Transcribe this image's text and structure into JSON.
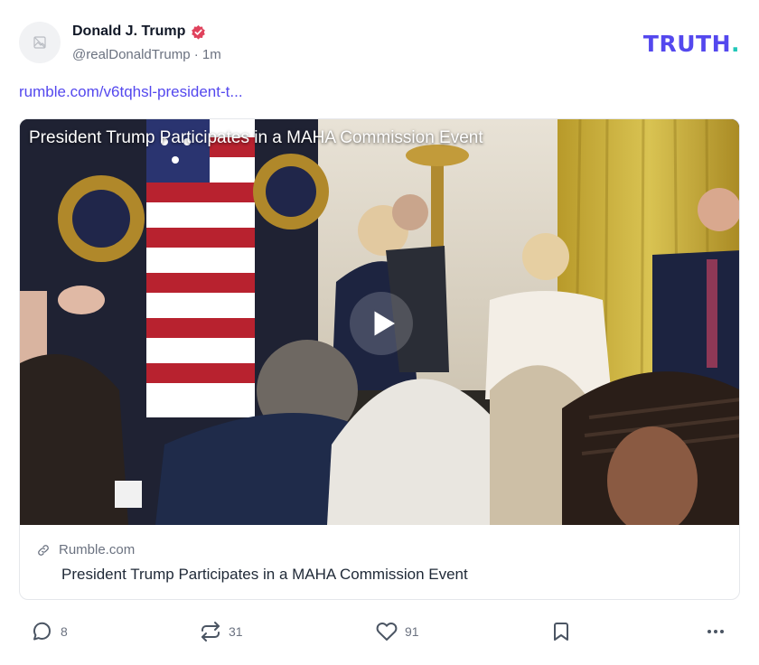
{
  "post": {
    "display_name": "Donald J. Trump",
    "handle": "@realDonaldTrump",
    "time_separator": " · ",
    "time": "1m",
    "link_text": "rumble.com/v6tqhsl-president-t...",
    "verified_icon": "verified-badge-icon",
    "avatar_icon": "image-placeholder-icon"
  },
  "brand": {
    "logo_text": "TRUTH",
    "logo_dot": ".",
    "logo_color": "#5448ee",
    "dot_color": "#22c7b8"
  },
  "card": {
    "video_title": "President Trump Participates in a MAHA Commission Event",
    "source": "Rumble.com",
    "title": "President Trump Participates in a MAHA Commission Event",
    "source_icon": "link-icon",
    "play_icon": "play-icon"
  },
  "actions": {
    "replies": "8",
    "retruths": "31",
    "likes": "91",
    "reply_icon": "comment-icon",
    "retruth_icon": "repost-icon",
    "like_icon": "heart-icon",
    "bookmark_icon": "bookmark-icon",
    "more_icon": "more-horizontal-icon"
  }
}
